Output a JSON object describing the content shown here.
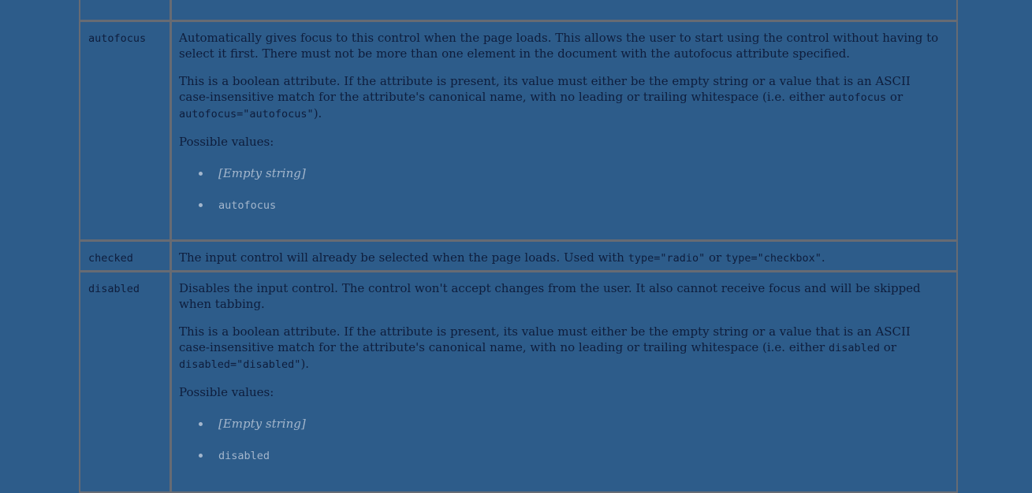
{
  "rows": [
    {
      "name": "",
      "description": ""
    },
    {
      "name": "autofocus",
      "p1": "Automatically gives focus to this control when the page loads. This allows the user to start using the control without having to select it first. There must not be more than one element in the document with the autofocus attribute specified.",
      "p2_a": "This is a boolean attribute. If the attribute is present, its value must either be the empty string or a value that is an ASCII case-insensitive match for the attribute's canonical name, with no leading or trailing whitespace (i.e. either ",
      "p2_code1": "autofocus",
      "p2_b": " or ",
      "p2_code2": "autofocus=\"autofocus\"",
      "p2_c": ").",
      "possible_label": "Possible values:",
      "values": [
        "[Empty string]",
        "autofocus"
      ]
    },
    {
      "name": "checked",
      "text_a": "The input control will already be selected when the page loads. Used with ",
      "code1": "type=\"radio\"",
      "text_b": " or ",
      "code2": "type=\"checkbox\"",
      "text_c": "."
    },
    {
      "name": "disabled",
      "p1": "Disables the input control. The control won't accept changes from the user. It also cannot receive focus and will be skipped when tabbing.",
      "p2_a": "This is a boolean attribute. If the attribute is present, its value must either be the empty string or a value that is an ASCII case-insensitive match for the attribute's canonical name, with no leading or trailing whitespace (i.e. either ",
      "p2_code1": "disabled",
      "p2_b": " or ",
      "p2_code2": "disabled=\"disabled\"",
      "p2_c": ").",
      "possible_label": "Possible values:",
      "values": [
        "[Empty string]",
        "disabled"
      ]
    }
  ]
}
